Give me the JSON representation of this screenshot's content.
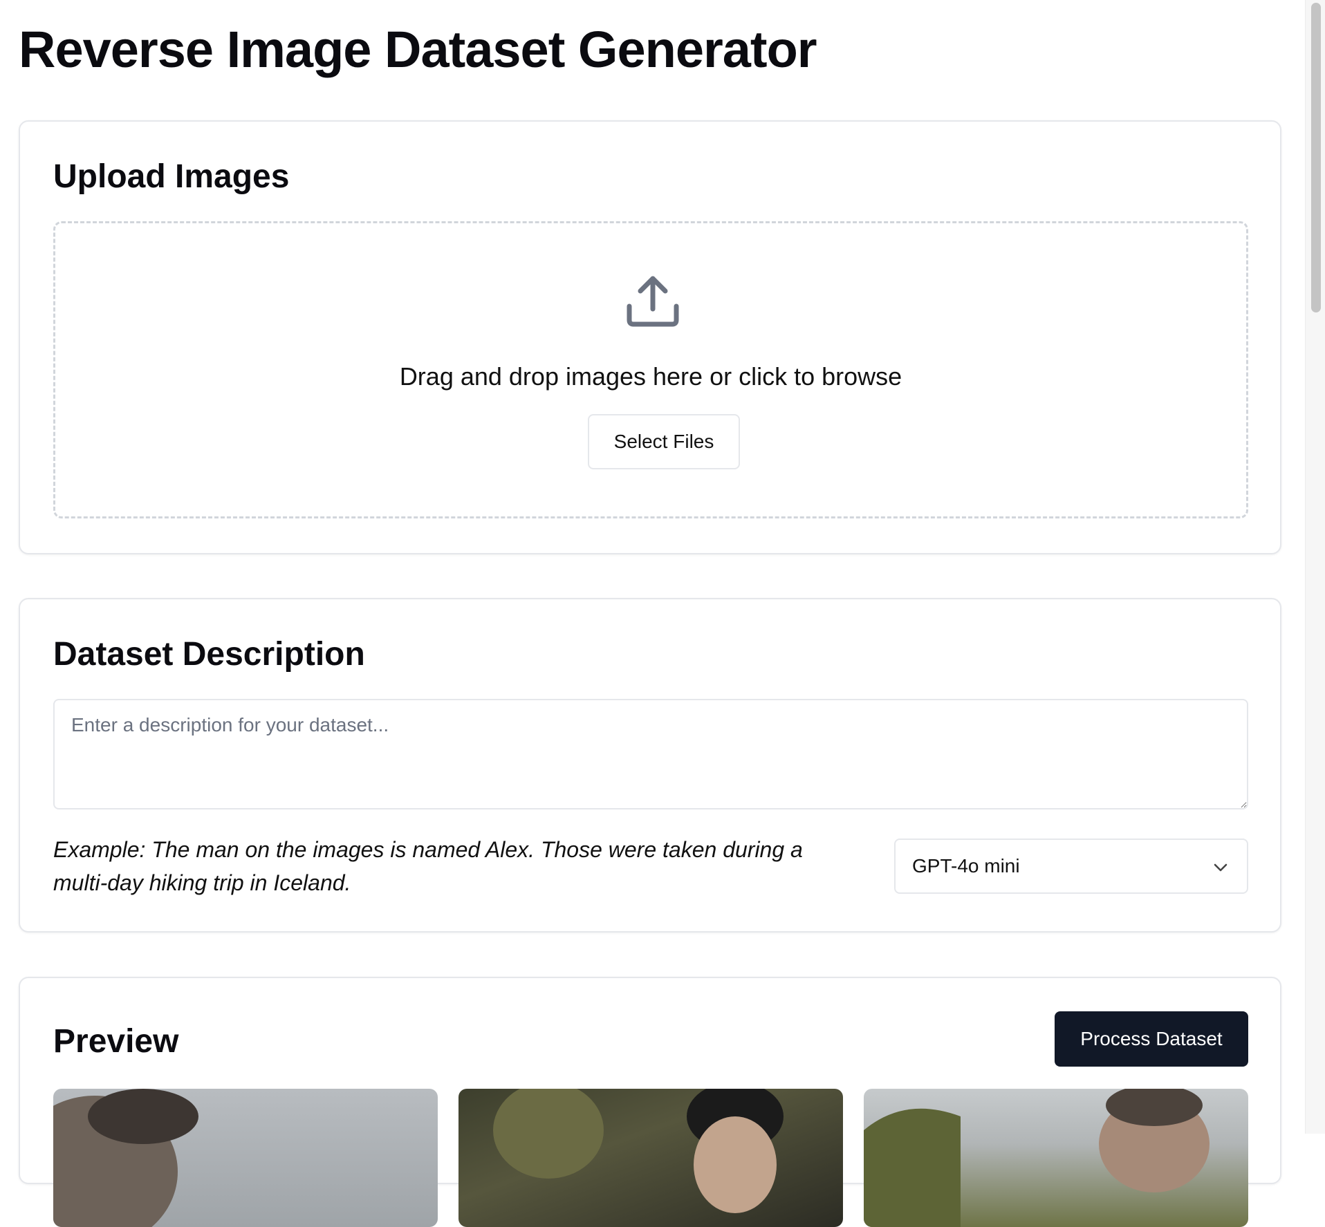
{
  "app": {
    "title": "Reverse Image Dataset Generator"
  },
  "upload": {
    "title": "Upload Images",
    "drop_text": "Drag and drop images here or click to browse",
    "select_button": "Select Files",
    "icon": "upload-icon"
  },
  "description": {
    "title": "Dataset Description",
    "placeholder": "Enter a description for your dataset...",
    "value": "",
    "example": "Example: The man on the images is named Alex. Those were taken during a multi-day hiking trip in Iceland."
  },
  "model": {
    "selected": "GPT-4o mini",
    "icon": "chevron-down-icon"
  },
  "preview": {
    "title": "Preview",
    "process_button": "Process Dataset",
    "images": [
      {
        "alt": ""
      },
      {
        "alt": ""
      },
      {
        "alt": ""
      }
    ]
  },
  "colors": {
    "primary_button": "#111827",
    "card_border": "#e5e7eb",
    "dropzone_border": "#d1d5db",
    "icon": "#6b7280"
  }
}
